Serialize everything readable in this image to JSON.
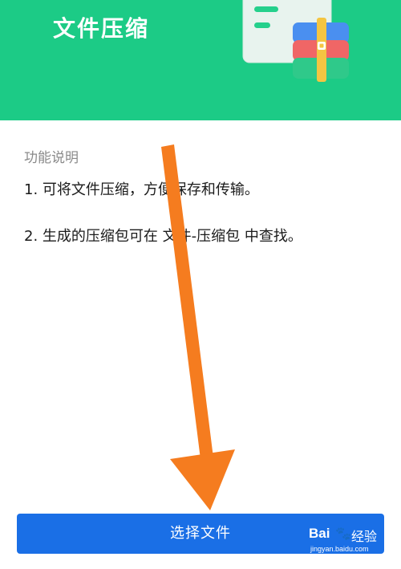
{
  "header": {
    "title": "文件压缩"
  },
  "content": {
    "section_title": "功能说明",
    "lines": [
      "1. 可将文件压缩，方便保存和传输。",
      "2. 生成的压缩包可在 文件-压缩包 中查找。"
    ]
  },
  "action": {
    "select_file_label": "选择文件"
  },
  "watermark": {
    "brand": "Bai",
    "paw": "🐾",
    "suffix": "经验",
    "url": "jingyan.baidu.com"
  },
  "colors": {
    "header_bg": "#1ccb86",
    "button_bg": "#1a6fe6",
    "arrow": "#f57c1f"
  }
}
